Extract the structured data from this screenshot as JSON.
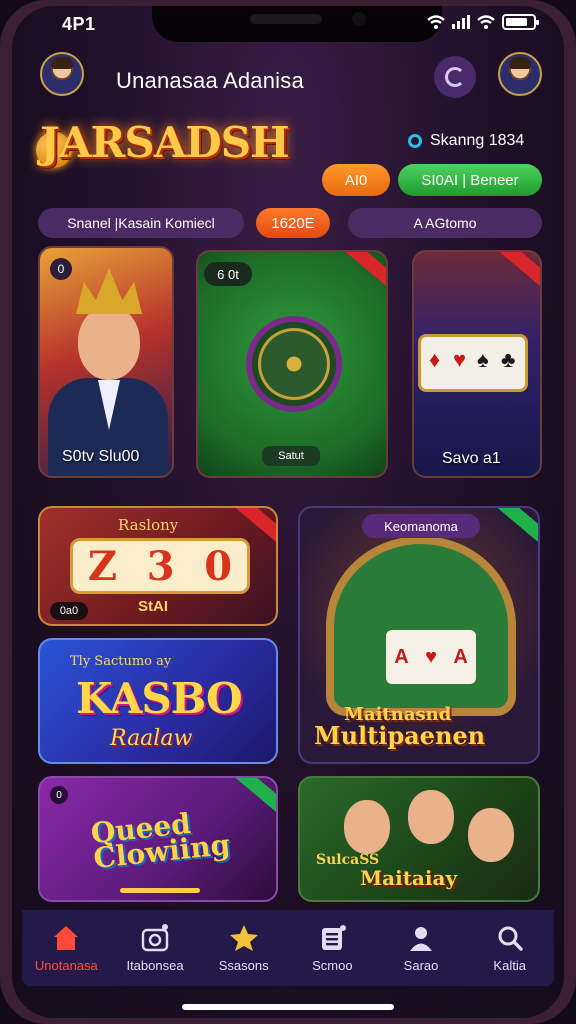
{
  "status_bar": {
    "time": "4P1"
  },
  "header": {
    "user_name": "Unanasaa Adanisa"
  },
  "brand": {
    "logo_text": "JARSADSH"
  },
  "balance": {
    "label": "Skanng 1834"
  },
  "actions": {
    "orange_button": "AI0",
    "green_button": "SI0AI | Beneer"
  },
  "promo_bar": {
    "text": "Snanel |Kasain Komiecl",
    "count": "1620E"
  },
  "search": {
    "text": "A  AGtomo"
  },
  "games": {
    "card1": {
      "badge": "0",
      "label": "S0tv Slu00"
    },
    "card2": {
      "badge": "6 0t",
      "button": "Satut"
    },
    "card3": {
      "label": "Savo a1"
    },
    "card4": {
      "title": "Raslony",
      "reels": [
        "Z",
        "3",
        "0"
      ],
      "chip": "0a0",
      "label": "StAI"
    },
    "card5": {
      "tag": "Keomanoma",
      "title_line1": "Maitnasnd",
      "title_line2": "Multipaenen"
    },
    "card6": {
      "small_text": "Tly Sactumo ay",
      "big_text": "KASBO",
      "sub_text": "Raalaw"
    },
    "card7": {
      "badge": "0",
      "title_line1": "Queed",
      "title_line2": "Clowiing"
    },
    "card8": {
      "tag": "SulcaSS",
      "title": "Maitaiay"
    }
  },
  "colors": {
    "accent_orange": "#ff8a1a",
    "accent_green": "#2fb63f",
    "nav_active": "#ff4a3a",
    "nav_bg": "#241a4a"
  },
  "bottom_nav": [
    {
      "label": "Unotanasa",
      "icon": "home-icon"
    },
    {
      "label": "Itabonsea",
      "icon": "camera-icon"
    },
    {
      "label": "Ssasons",
      "icon": "star-icon"
    },
    {
      "label": "Scmoo",
      "icon": "document-icon"
    },
    {
      "label": "Sarao",
      "icon": "person-icon"
    },
    {
      "label": "Kaltia",
      "icon": "search-icon"
    }
  ]
}
